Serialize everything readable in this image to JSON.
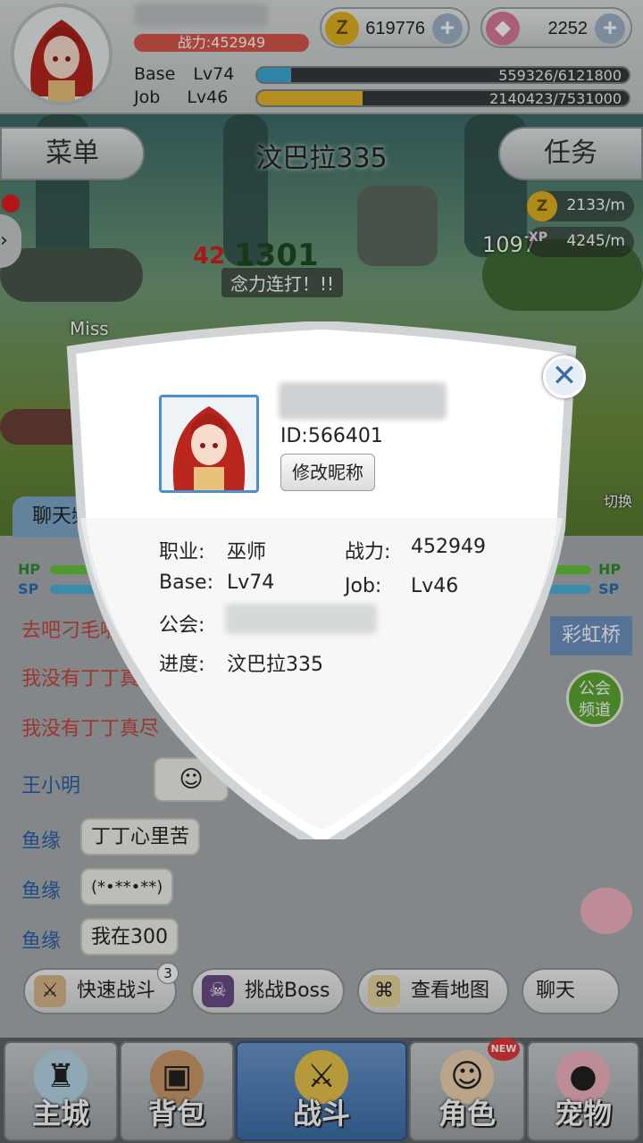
{
  "header": {
    "power_text": "战力:452949",
    "currency_gold": "619776",
    "currency_gem": "2252",
    "base_label": "Base",
    "base_level": "Lv74",
    "base_exp": "559326/6121800",
    "base_exp_fraction": 0.0914,
    "job_label": "Job",
    "job_level": "Lv46",
    "job_exp": "2140423/7531000",
    "job_exp_fraction": 0.2842,
    "colors": {
      "base_bar": "#3ea9d8",
      "job_bar": "#e7b62e",
      "power_pill": "#d9584e"
    }
  },
  "scene": {
    "menu_label": "菜单",
    "task_label": "任务",
    "stage_title": "汶巴拉335",
    "gold_rate": "2133/m",
    "xp_rate": "4245/m",
    "xp_badge": "XP",
    "damage_small": "42",
    "damage_big": "1301",
    "level_hit": "1097",
    "skill_text": "念力连打！!!",
    "miss_text": "Miss",
    "switch_label": "切换"
  },
  "chat": {
    "tab_label": "聊天频",
    "hp_label": "HP",
    "sp_label": "SP",
    "channel_label": "彩虹桥",
    "guild_channel": [
      "公会",
      "频道"
    ],
    "lines": [
      {
        "name": "去吧刁毛啦",
        "text": ""
      },
      {
        "name": "我没有丁丁真",
        "text": ""
      },
      {
        "name": "我没有丁丁真尽",
        "text": ""
      },
      {
        "name": "王小明",
        "text": ""
      },
      {
        "name": "鱼缘",
        "text": "丁丁心里苦"
      },
      {
        "name": "鱼缘",
        "text": "(*•**•**)"
      },
      {
        "name": "鱼缘",
        "text": "我在300"
      }
    ],
    "actions": {
      "quick_battle": "快速战斗",
      "quick_battle_badge": "3",
      "challenge_boss": "挑战Boss",
      "view_map": "查看地图",
      "chat_toggle": "聊天"
    }
  },
  "nav": {
    "items": [
      {
        "label": "主城",
        "icon": "castle-icon"
      },
      {
        "label": "背包",
        "icon": "backpack-icon"
      },
      {
        "label": "战斗",
        "icon": "battle-icon"
      },
      {
        "label": "角色",
        "icon": "character-icon"
      },
      {
        "label": "宠物",
        "icon": "pet-icon"
      }
    ],
    "new_badge": "NEW"
  },
  "profile_dialog": {
    "id_text": "ID:566401",
    "rename_label": "修改昵称",
    "class_label": "职业:",
    "class_value": "巫师",
    "power_label": "战力:",
    "power_value": "452949",
    "base_label": "Base:",
    "base_value": "Lv74",
    "job_label": "Job:",
    "job_value": "Lv46",
    "guild_label": "公会:",
    "progress_label": "进度:",
    "progress_value": "汶巴拉335",
    "close_symbol": "✕"
  }
}
